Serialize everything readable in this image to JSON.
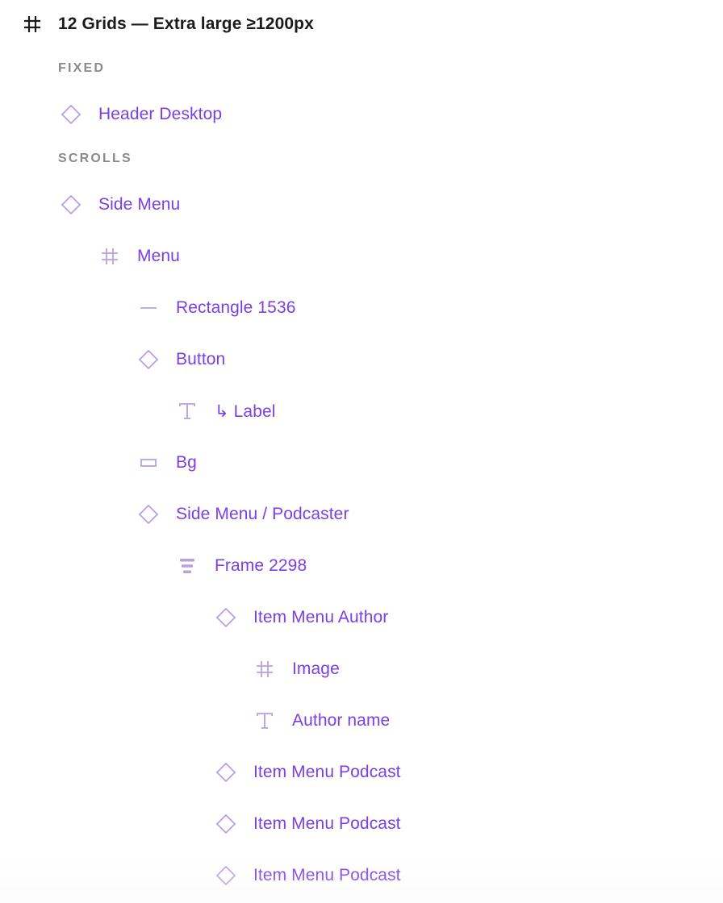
{
  "root": {
    "title": "12 Grids — Extra large ≥1200px",
    "icon": "frame-hash-icon"
  },
  "sections": {
    "fixed": "FIXED",
    "scrolls": "SCROLLS"
  },
  "layers": [
    {
      "label": "Header Desktop",
      "icon": "component-instance-icon"
    },
    {
      "label": "Side Menu",
      "icon": "component-instance-icon"
    },
    {
      "label": "Menu",
      "icon": "frame-hash-icon"
    },
    {
      "label": "Rectangle 1536",
      "icon": "line-icon"
    },
    {
      "label": "Button",
      "icon": "component-instance-icon"
    },
    {
      "label": "↳ Label",
      "icon": "text-icon"
    },
    {
      "label": "Bg",
      "icon": "rectangle-icon"
    },
    {
      "label": "Side Menu / Podcaster",
      "icon": "component-instance-icon"
    },
    {
      "label": "Frame 2298",
      "icon": "auto-layout-icon"
    },
    {
      "label": "Item Menu Author",
      "icon": "component-instance-icon"
    },
    {
      "label": "Image",
      "icon": "frame-hash-icon"
    },
    {
      "label": "Author name",
      "icon": "text-icon"
    },
    {
      "label": "Item Menu Podcast",
      "icon": "component-instance-icon"
    },
    {
      "label": "Item Menu Podcast",
      "icon": "component-instance-icon"
    },
    {
      "label": "Item Menu Podcast",
      "icon": "component-instance-icon"
    }
  ],
  "colors": {
    "accent": "#7b3fe4",
    "icon_light": "#b9a0e3",
    "root_text": "#1b1b1b",
    "section_text": "#8a8a8a"
  }
}
